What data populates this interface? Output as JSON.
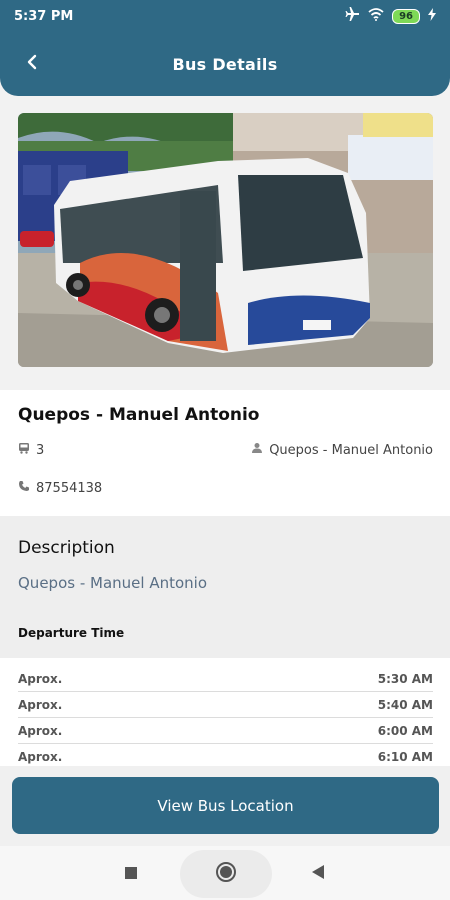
{
  "status_bar": {
    "time": "5:37 PM",
    "battery": "96"
  },
  "header": {
    "title": "Bus Details"
  },
  "bus": {
    "route_name": "Quepos - Manuel Antonio",
    "seats": "3",
    "driver": "Quepos - Manuel Antonio",
    "phone": "87554138"
  },
  "description": {
    "heading": "Description",
    "text": "Quepos - Manuel Antonio",
    "departure_heading": "Departure Time"
  },
  "schedule": [
    {
      "label": "Aprox.",
      "time": "5:30 AM"
    },
    {
      "label": "Aprox.",
      "time": "5:40 AM"
    },
    {
      "label": "Aprox.",
      "time": "6:00 AM"
    },
    {
      "label": "Aprox.",
      "time": "6:10 AM"
    }
  ],
  "actions": {
    "view_location": "View Bus Location"
  },
  "colors": {
    "primary": "#2f6985",
    "battery": "#7ed957"
  }
}
